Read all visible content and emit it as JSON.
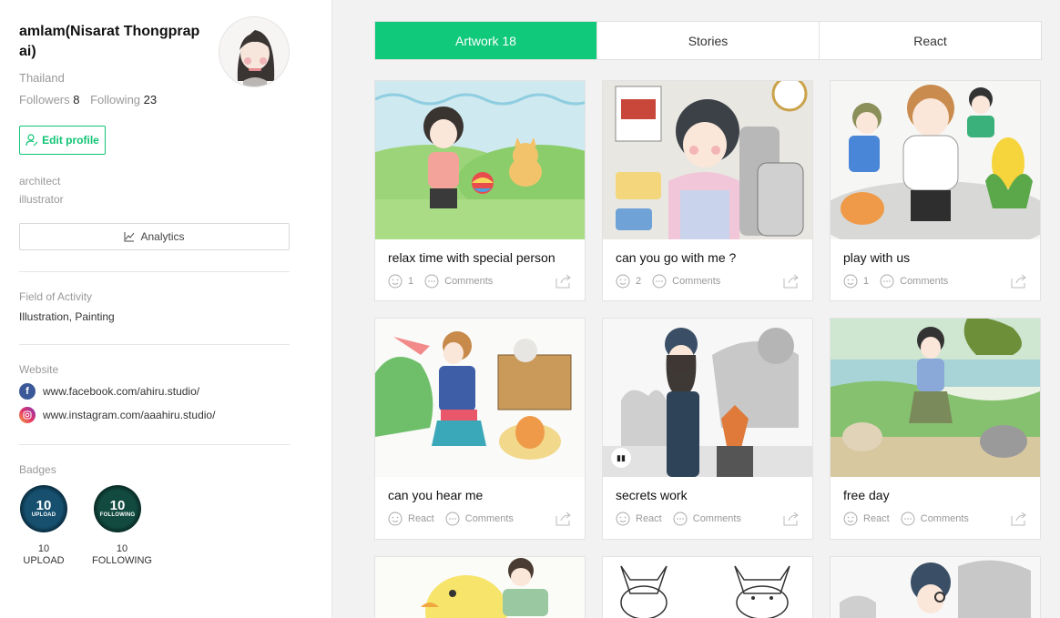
{
  "profile": {
    "name": "amlam(Nisarat Thongprapai)",
    "country": "Thailand",
    "followers_label": "Followers",
    "followers_count": "8",
    "following_label": "Following",
    "following_count": "23",
    "edit_label": "Edit profile",
    "roles": [
      "architect",
      "illustrator"
    ],
    "analytics_label": "Analytics"
  },
  "field": {
    "label": "Field of Activity",
    "value": "Illustration, Painting"
  },
  "website": {
    "label": "Website",
    "links": [
      {
        "icon": "facebook-icon",
        "url": "www.facebook.com/ahiru.studio/"
      },
      {
        "icon": "instagram-icon",
        "url": "www.instagram.com/aaahiru.studio/"
      }
    ]
  },
  "badges": {
    "label": "Badges",
    "items": [
      {
        "num": "10",
        "inner": "UPLOAD",
        "caption_num": "10",
        "caption": "UPLOAD",
        "color": "#0f3a52"
      },
      {
        "num": "10",
        "inner": "FOLLOWING",
        "caption_num": "10",
        "caption": "FOLLOWING",
        "color": "#0c3b34"
      }
    ]
  },
  "tabs": [
    {
      "label": "Artwork 18",
      "active": true
    },
    {
      "label": "Stories",
      "active": false
    },
    {
      "label": "React",
      "active": false
    }
  ],
  "cards": [
    {
      "title": "relax time with special person",
      "react": "1",
      "comments": "Comments"
    },
    {
      "title": "can you go with me ?",
      "react": "2",
      "comments": "Comments"
    },
    {
      "title": "play with us",
      "react": "1",
      "comments": "Comments"
    },
    {
      "title": "can you hear me",
      "react": "React",
      "comments": "Comments"
    },
    {
      "title": "secrets work",
      "react": "React",
      "comments": "Comments"
    },
    {
      "title": "free day",
      "react": "React",
      "comments": "Comments"
    }
  ],
  "colors": {
    "accent": "#10c97a",
    "edit_green": "#10c474"
  }
}
